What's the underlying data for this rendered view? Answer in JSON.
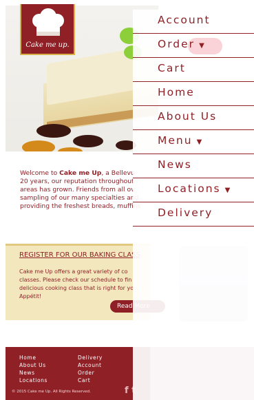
{
  "logo": {
    "text": "Cake me up."
  },
  "intro": {
    "lines": [
      "Welcome to ",
      "Cake me Up",
      ", a Bellevu",
      "20 years, our reputation throughout",
      "areas has grown. Friends from all ov",
      "sampling of our many specialties and",
      "providing the freshest breads, muffins"
    ]
  },
  "class_section": {
    "title": "REGISTER FOR OUR BAKING CLASS",
    "text_lines": [
      "Cake me Up offers a great variety of co",
      "classes. Please check our schedule to fin",
      "delicious cooking class that is right for yo",
      "Appétit!"
    ],
    "button": "Read More"
  },
  "footer": {
    "col1": [
      "Home",
      "About Us",
      "News",
      "Locations"
    ],
    "col2": [
      "Delivery",
      "Account",
      "Order",
      "Cart"
    ],
    "copyright": "© 2015 Cake me Up. All Rights Reserved.",
    "social": "f t"
  },
  "menu": {
    "items": [
      {
        "label": "Account",
        "dropdown": false
      },
      {
        "label": "Order",
        "dropdown": true
      },
      {
        "label": "Cart",
        "dropdown": false
      },
      {
        "label": "Home",
        "dropdown": false
      },
      {
        "label": "About Us",
        "dropdown": false
      },
      {
        "label": "Menu",
        "dropdown": true
      },
      {
        "label": "News",
        "dropdown": false
      },
      {
        "label": "Locations",
        "dropdown": true
      },
      {
        "label": "Delivery",
        "dropdown": false
      }
    ],
    "caret": "▼"
  },
  "colors": {
    "brand": "#8f2026",
    "gold": "#d8b14a",
    "cream": "#f3e7bd"
  }
}
